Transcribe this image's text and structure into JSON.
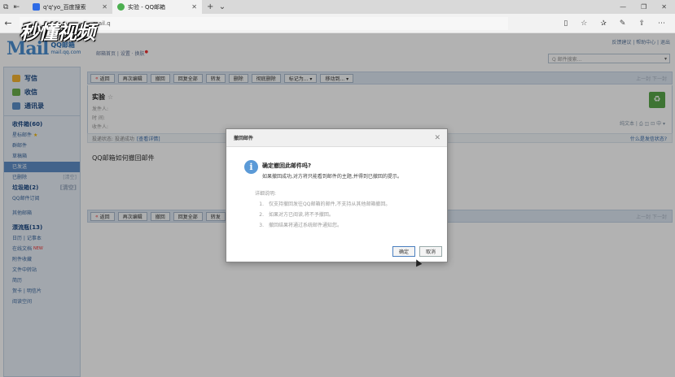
{
  "browser": {
    "tabs": [
      {
        "label": "q'q'yo_百度搜索",
        "active": false,
        "favicon_color": "#2e6be6"
      },
      {
        "label": "实验 - QQ邮箱",
        "active": true,
        "favicon_color": "#4caf50"
      }
    ],
    "address_partial": "mail.q",
    "watermark": "秒懂视频"
  },
  "header": {
    "logo_big": "Mail",
    "logo_cn": "QQ邮箱",
    "logo_domain": "mail.qq.com",
    "user_nav": "邮箱首页 | 设置 · 换肤",
    "top_links": "反馈建议 | 帮助中心 | 退出",
    "search_placeholder": "Q 邮件搜索..."
  },
  "sidebar": {
    "compose": "写信",
    "inbox": "收信",
    "contacts": "通讯录",
    "folders": [
      {
        "label": "收件箱(60)",
        "bold": true
      },
      {
        "label": "星标邮件",
        "star": true
      },
      {
        "label": "群邮件"
      },
      {
        "label": "草稿箱"
      },
      {
        "label": "已发送",
        "selected": true
      },
      {
        "label": "已删除",
        "extra": "[清空]"
      },
      {
        "label": "垃圾箱(2)",
        "extra": "[清空]",
        "bold": true
      },
      {
        "label": "QQ邮件订阅"
      }
    ],
    "other_mailbox": "其他邮箱",
    "apps": [
      {
        "label": "漂流瓶(13)",
        "bold": true
      },
      {
        "label": "日历 | 记事本"
      },
      {
        "label": "在线文档",
        "badge": "NEW"
      },
      {
        "label": "附件收藏"
      },
      {
        "label": "文件中转站"
      },
      {
        "label": "简历"
      },
      {
        "label": "贺卡 | 明信片"
      },
      {
        "label": "阅读空间"
      }
    ]
  },
  "toolbar": {
    "back": "返回",
    "buttons": [
      "再次编辑",
      "撤回",
      "回复全部",
      "转发",
      "删除",
      "彻底删除",
      "标记为... ▾",
      "移动到... ▾"
    ],
    "buttons_bottom": [
      "再次编辑",
      "撤回",
      "回复全部",
      "转发"
    ],
    "pager": "上一封  下一封"
  },
  "mail": {
    "subject": "实验",
    "sender_label": "发件人:",
    "time_label": "时   间:",
    "recipient_label": "收件人:",
    "plaintext": "纯文本 | ⎙ ◫ ⊡ 中 ▾",
    "receipt_status": "投递状态:  投递成功",
    "receipt_link": "[查看详情]",
    "spam_question": "什么是发信状态?",
    "body": "QQ邮箱如何撤回邮件"
  },
  "dialog": {
    "title": "撤回邮件",
    "question": "确定撤回此邮件吗?",
    "description": "如果撤回成功,对方将只能看到邮件的主题,并得到已撤回的提示。",
    "detail_heading": "详细说明:",
    "details": [
      "仅支持撤回发往QQ邮箱的邮件,不支持从其他邮箱撤回。",
      "如果对方已阅读,将不予撤回。",
      "撤回结果将通过系统邮件通知您。"
    ],
    "confirm": "确定",
    "cancel": "取消"
  }
}
